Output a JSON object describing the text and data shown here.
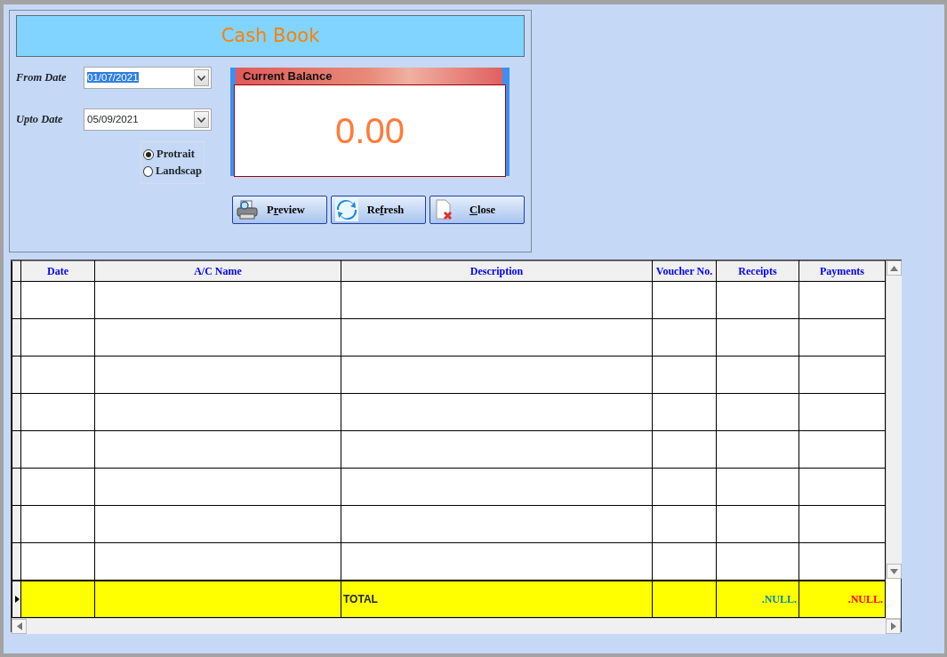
{
  "title": "Cash Book",
  "date_fields": [
    {
      "label": "From Date",
      "value": "01/07/2021",
      "text_selected": true
    },
    {
      "label": "Upto Date",
      "value": "05/09/2021",
      "text_selected": false
    }
  ],
  "orientation": [
    {
      "label": "Protrait",
      "selected": true
    },
    {
      "label": "Landscap",
      "selected": false
    }
  ],
  "balance": {
    "title": "Current Balance",
    "value": "0.00"
  },
  "buttons": [
    {
      "kind": "preview",
      "label_before": "P",
      "accel_key": "r",
      "label_after": "eview"
    },
    {
      "kind": "refresh",
      "label_before": "Re",
      "accel_key": "f",
      "label_after": "resh"
    },
    {
      "kind": "close",
      "accel_key": "C",
      "label_after": "lose"
    }
  ],
  "table": {
    "columns": [
      "Date",
      "A/C Name",
      "Description",
      "Voucher No.",
      "Receipts",
      "Payments"
    ],
    "rows": [
      {
        "current": false
      },
      {
        "current": false
      },
      {
        "current": false
      },
      {
        "current": false
      },
      {
        "current": false
      },
      {
        "current": false
      },
      {
        "current": false
      },
      {
        "current": false
      }
    ],
    "total_row": {
      "current": true,
      "label": "TOTAL",
      "receipts": ".NULL.",
      "payments": ".NULL."
    }
  }
}
